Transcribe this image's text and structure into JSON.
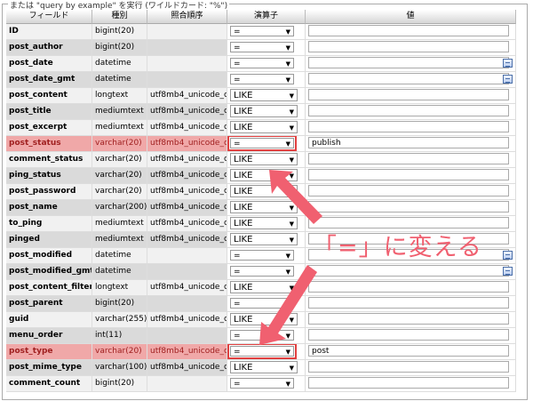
{
  "legend": "または \"query by example\" を実行 (ワイルドカード: \"%\")",
  "headers": [
    "フィールド",
    "種別",
    "照合順序",
    "演算子",
    "値"
  ],
  "rows": [
    {
      "field": "ID",
      "type": "bigint(20)",
      "collation": "",
      "operator": "=",
      "value": "",
      "cal": false
    },
    {
      "field": "post_author",
      "type": "bigint(20)",
      "collation": "",
      "operator": "=",
      "value": "",
      "cal": false
    },
    {
      "field": "post_date",
      "type": "datetime",
      "collation": "",
      "operator": "=",
      "value": "",
      "cal": true
    },
    {
      "field": "post_date_gmt",
      "type": "datetime",
      "collation": "",
      "operator": "=",
      "value": "",
      "cal": true
    },
    {
      "field": "post_content",
      "type": "longtext",
      "collation": "utf8mb4_unicode_ci",
      "operator": "LIKE",
      "value": "",
      "cal": false
    },
    {
      "field": "post_title",
      "type": "mediumtext",
      "collation": "utf8mb4_unicode_ci",
      "operator": "LIKE",
      "value": "",
      "cal": false
    },
    {
      "field": "post_excerpt",
      "type": "mediumtext",
      "collation": "utf8mb4_unicode_ci",
      "operator": "LIKE",
      "value": "",
      "cal": false
    },
    {
      "field": "post_status",
      "type": "varchar(20)",
      "collation": "utf8mb4_unicode_ci",
      "operator": "=",
      "value": "publish",
      "cal": false,
      "highlight": true
    },
    {
      "field": "comment_status",
      "type": "varchar(20)",
      "collation": "utf8mb4_unicode_ci",
      "operator": "LIKE",
      "value": "",
      "cal": false
    },
    {
      "field": "ping_status",
      "type": "varchar(20)",
      "collation": "utf8mb4_unicode_ci",
      "operator": "LIKE",
      "value": "",
      "cal": false
    },
    {
      "field": "post_password",
      "type": "varchar(20)",
      "collation": "utf8mb4_unicode_ci",
      "operator": "LIKE",
      "value": "",
      "cal": false
    },
    {
      "field": "post_name",
      "type": "varchar(200)",
      "collation": "utf8mb4_unicode_ci",
      "operator": "LIKE",
      "value": "",
      "cal": false
    },
    {
      "field": "to_ping",
      "type": "mediumtext",
      "collation": "utf8mb4_unicode_ci",
      "operator": "LIKE",
      "value": "",
      "cal": false
    },
    {
      "field": "pinged",
      "type": "mediumtext",
      "collation": "utf8mb4_unicode_ci",
      "operator": "LIKE",
      "value": "",
      "cal": false
    },
    {
      "field": "post_modified",
      "type": "datetime",
      "collation": "",
      "operator": "=",
      "value": "",
      "cal": true
    },
    {
      "field": "post_modified_gmt",
      "type": "datetime",
      "collation": "",
      "operator": "=",
      "value": "",
      "cal": true
    },
    {
      "field": "post_content_filtered",
      "type": "longtext",
      "collation": "utf8mb4_unicode_ci",
      "operator": "LIKE",
      "value": "",
      "cal": false
    },
    {
      "field": "post_parent",
      "type": "bigint(20)",
      "collation": "",
      "operator": "=",
      "value": "",
      "cal": false
    },
    {
      "field": "guid",
      "type": "varchar(255)",
      "collation": "utf8mb4_unicode_ci",
      "operator": "LIKE",
      "value": "",
      "cal": false
    },
    {
      "field": "menu_order",
      "type": "int(11)",
      "collation": "",
      "operator": "=",
      "value": "",
      "cal": false
    },
    {
      "field": "post_type",
      "type": "varchar(20)",
      "collation": "utf8mb4_unicode_ci",
      "operator": "=",
      "value": "post",
      "cal": false,
      "highlight": true
    },
    {
      "field": "post_mime_type",
      "type": "varchar(100)",
      "collation": "utf8mb4_unicode_ci",
      "operator": "LIKE",
      "value": "",
      "cal": false
    },
    {
      "field": "comment_count",
      "type": "bigint(20)",
      "collation": "",
      "operator": "=",
      "value": "",
      "cal": false
    }
  ],
  "annotation": "「=」に変える",
  "colors": {
    "highlight_bg": "#f0a8a8",
    "highlight_border": "#e04040",
    "arrow": "#f06070"
  }
}
